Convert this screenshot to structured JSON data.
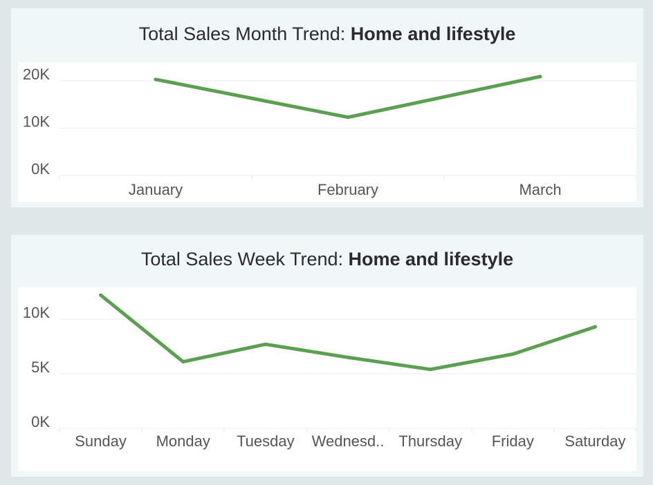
{
  "charts": [
    {
      "title_prefix": "Total Sales Month Trend: ",
      "title_bold": "Home and lifestyle"
    },
    {
      "title_prefix": "Total Sales Week Trend: ",
      "title_bold": "Home and lifestyle"
    }
  ],
  "colors": {
    "line": "#5aa050",
    "background": "#dfe8e9",
    "card": "#f0f8f7",
    "plot": "#ffffff",
    "grid": "#ececec"
  },
  "chart_data": [
    {
      "type": "line",
      "title": "Total Sales Month Trend: Home and lifestyle",
      "categories": [
        "January",
        "February",
        "March"
      ],
      "values": [
        20300,
        12300,
        20900
      ],
      "yticks": [
        "0K",
        "10K",
        "20K"
      ],
      "ytick_values": [
        0,
        10000,
        20000
      ],
      "ylim": [
        0,
        20000
      ],
      "grid": true
    },
    {
      "type": "line",
      "title": "Total Sales Week Trend: Home and lifestyle",
      "categories": [
        "Sunday",
        "Monday",
        "Tuesday",
        "Wednesd..",
        "Thursday",
        "Friday",
        "Saturday"
      ],
      "values": [
        12200,
        6100,
        7700,
        6500,
        5400,
        6800,
        9300
      ],
      "yticks": [
        "0K",
        "5K",
        "10K"
      ],
      "ytick_values": [
        0,
        5000,
        10000
      ],
      "ylim": [
        0,
        10000
      ],
      "grid": true
    }
  ]
}
